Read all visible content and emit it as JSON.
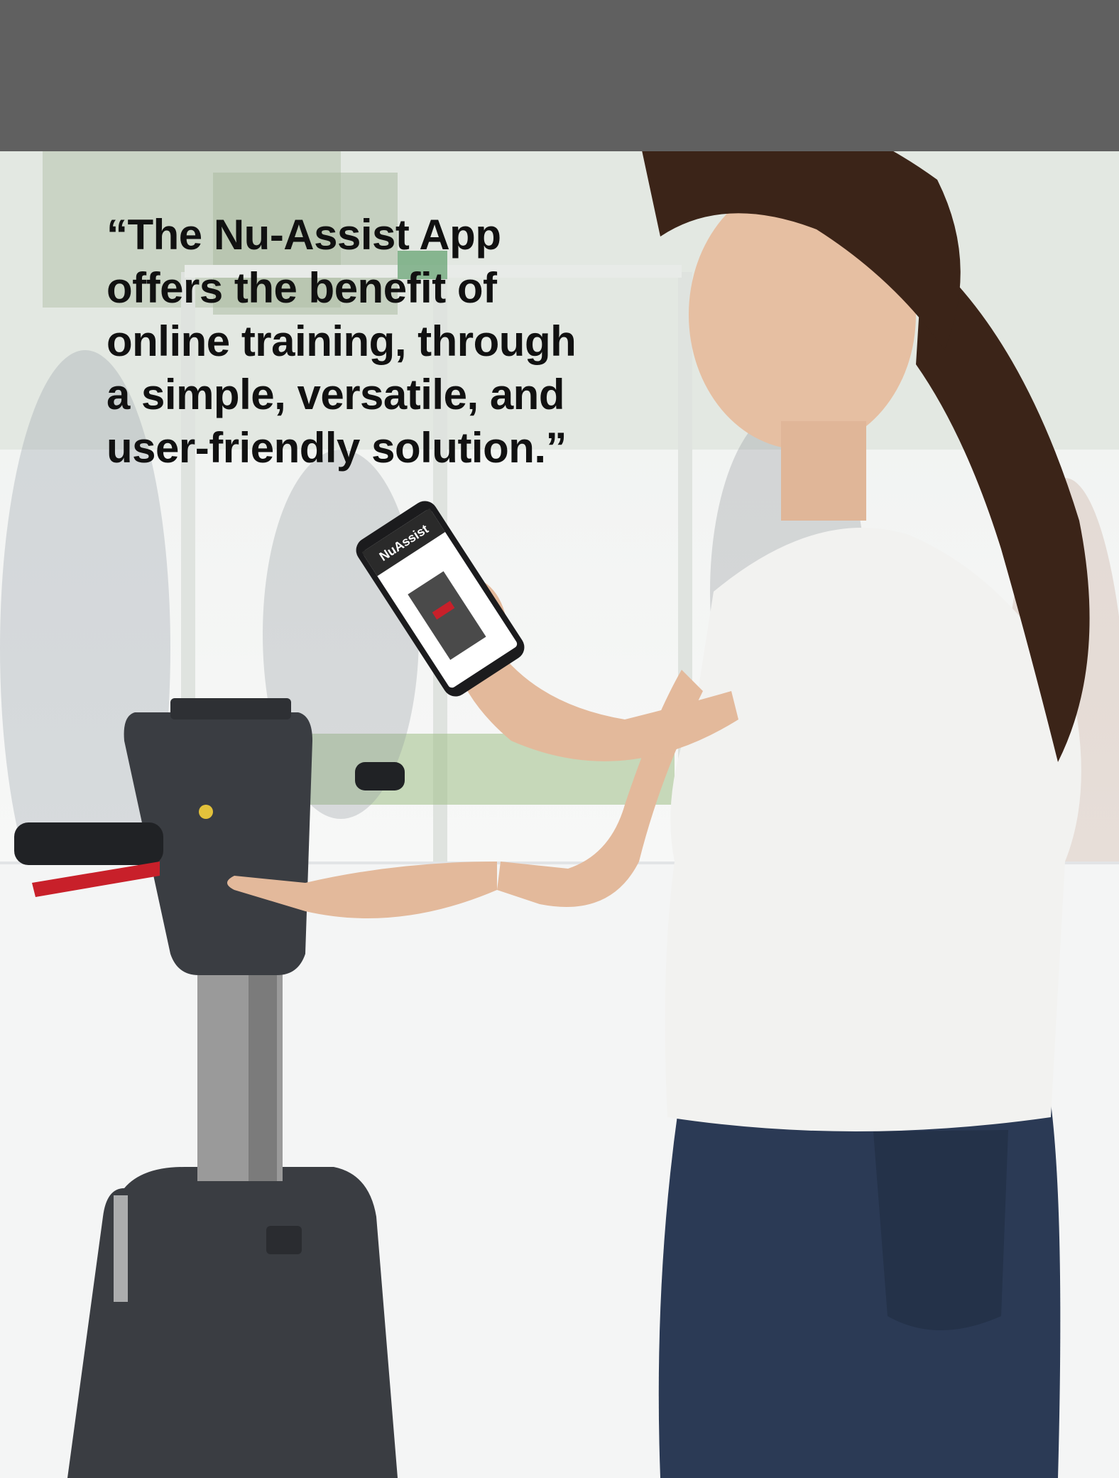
{
  "hero": {
    "quote_lines": [
      "“The Nu-Assist App",
      "offers the benefit of",
      "online training, through",
      "a simple, versatile, and",
      "user-friendly solution.”"
    ]
  },
  "phone_screen": {
    "app_name": "NuAssist"
  },
  "colors": {
    "top_band": "#606060",
    "machine_body": "#3a3d42",
    "machine_accent": "#c8202a",
    "shirt": "#f2f2f0",
    "jeans": "#2b3a55",
    "hair": "#3b2418"
  }
}
